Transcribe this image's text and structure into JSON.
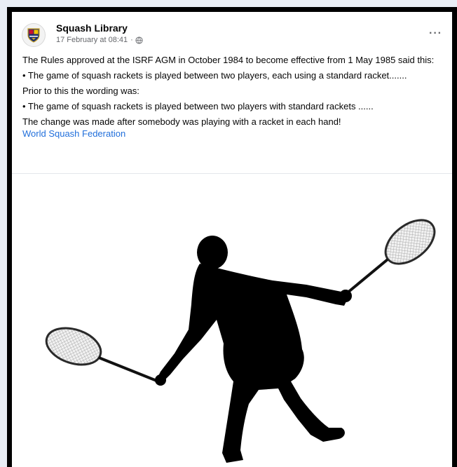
{
  "post": {
    "page_name": "Squash Library",
    "timestamp": "17 February at 08:41",
    "separator": "·",
    "privacy_icon": "globe-icon",
    "more_label": "···",
    "paragraphs": [
      "The Rules approved at the ISRF AGM in October 1984 to become effective from 1 May 1985 said this:",
      "• The game of squash rackets is played between two players, each using a standard racket.......",
      "Prior to this the wording was:",
      "• The game of squash rackets is played between two players with standard rackets ......",
      "The change was made after somebody was playing with a racket in each hand!"
    ],
    "link_text": "World Squash Federation",
    "image": {
      "subject": "squash-player-silhouette"
    }
  },
  "colors": {
    "background": "#e9eef5",
    "link": "#216fdb",
    "meta_text": "#65676b"
  }
}
